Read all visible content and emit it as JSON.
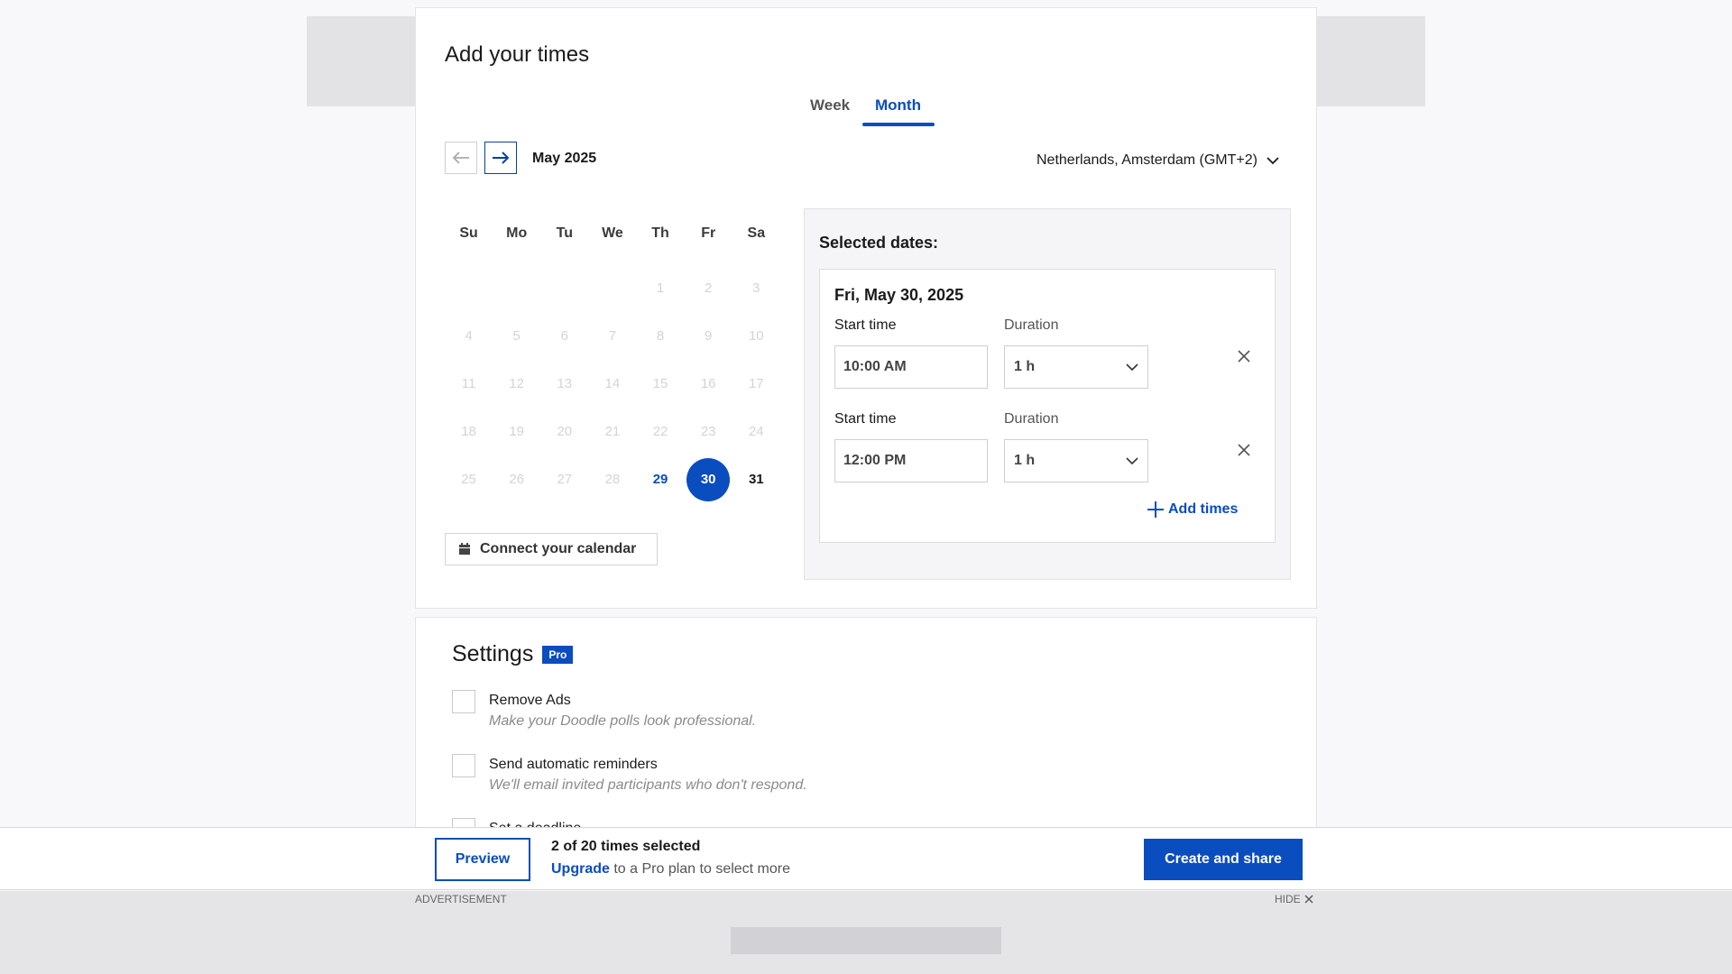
{
  "header": {
    "title": "Add your times"
  },
  "tabs": [
    {
      "label": "Week"
    },
    {
      "label": "Month"
    }
  ],
  "calendar": {
    "month_label": "May 2025",
    "weekdays": [
      "Su",
      "Mo",
      "Tu",
      "We",
      "Th",
      "Fr",
      "Sa"
    ],
    "rows": [
      [
        "",
        "",
        "",
        "",
        "1",
        "2",
        "3"
      ],
      [
        "4",
        "5",
        "6",
        "7",
        "8",
        "9",
        "10"
      ],
      [
        "11",
        "12",
        "13",
        "14",
        "15",
        "16",
        "17"
      ],
      [
        "18",
        "19",
        "20",
        "21",
        "22",
        "23",
        "24"
      ],
      [
        "25",
        "26",
        "27",
        "28",
        "29",
        "30",
        "31"
      ]
    ],
    "today": "29",
    "selected": "30",
    "active": [
      "31"
    ],
    "connect_label": "Connect your calendar"
  },
  "timezone": {
    "label": "Netherlands, Amsterdam (GMT+2)"
  },
  "selected_dates": {
    "title": "Selected dates:",
    "date_label": "Fri, May 30, 2025",
    "start_label": "Start time",
    "duration_label": "Duration",
    "slots": [
      {
        "start": "10:00 AM",
        "duration": "1 h"
      },
      {
        "start": "12:00 PM",
        "duration": "1 h"
      }
    ],
    "add_label": "Add times"
  },
  "settings": {
    "title": "Settings",
    "badge": "Pro",
    "options": [
      {
        "label": "Remove Ads",
        "desc": "Make your Doodle polls look professional."
      },
      {
        "label": "Send automatic reminders",
        "desc": "We'll email invited participants who don't respond."
      },
      {
        "label": "Set a deadline",
        "desc": ""
      }
    ]
  },
  "bottom_bar": {
    "preview_label": "Preview",
    "count_text": "2 of 20 times selected",
    "upgrade_link": "Upgrade",
    "upgrade_rest": " to a Pro plan to select more",
    "create_label": "Create and share"
  },
  "ad": {
    "label": "ADVERTISEMENT",
    "hide_label": "HIDE"
  },
  "colors": {
    "accent": "#0a4dbf",
    "muted_day": "#d4d4d8",
    "panel_bg": "#f5f5f7"
  }
}
